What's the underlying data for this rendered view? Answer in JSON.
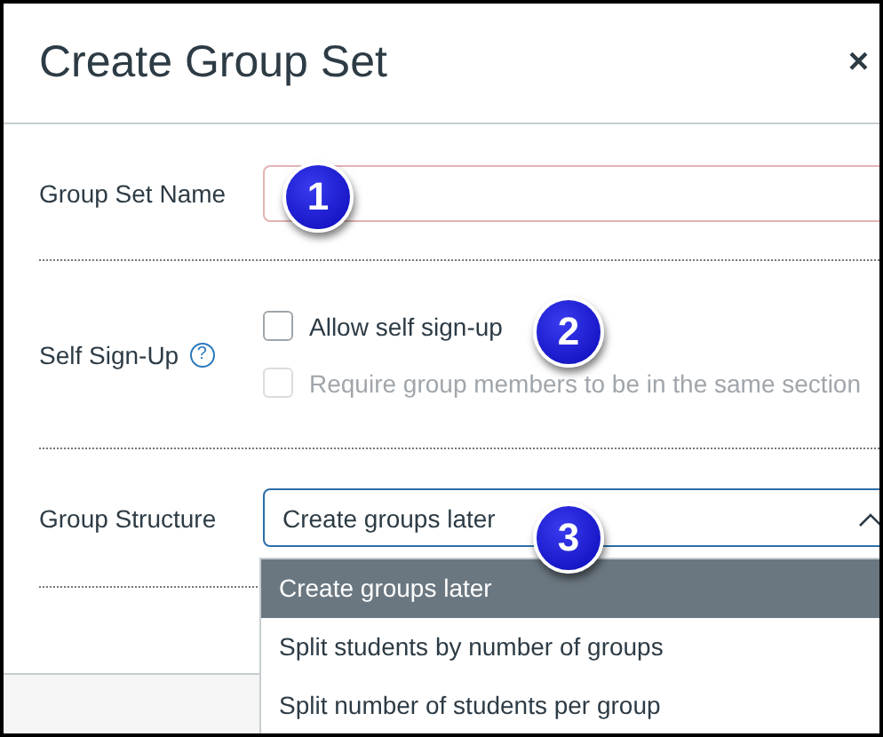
{
  "dialog": {
    "title": "Create Group Set",
    "close": "×"
  },
  "name_field": {
    "label": "Group Set Name",
    "invalid": true
  },
  "self_signup": {
    "label": "Self Sign-Up",
    "help": "?",
    "options": [
      {
        "label": "Allow self sign-up",
        "checked": false,
        "disabled": false
      },
      {
        "label": "Require group members to be in the same section",
        "checked": false,
        "disabled": true
      }
    ]
  },
  "group_structure": {
    "label": "Group Structure",
    "value": "Create groups later",
    "expanded": true,
    "options": [
      {
        "label": "Create groups later",
        "selected": true
      },
      {
        "label": "Split students by number of groups",
        "selected": false
      },
      {
        "label": "Split number of students per group",
        "selected": false
      }
    ]
  },
  "callouts": [
    {
      "number": "1"
    },
    {
      "number": "2"
    },
    {
      "number": "3"
    }
  ]
}
